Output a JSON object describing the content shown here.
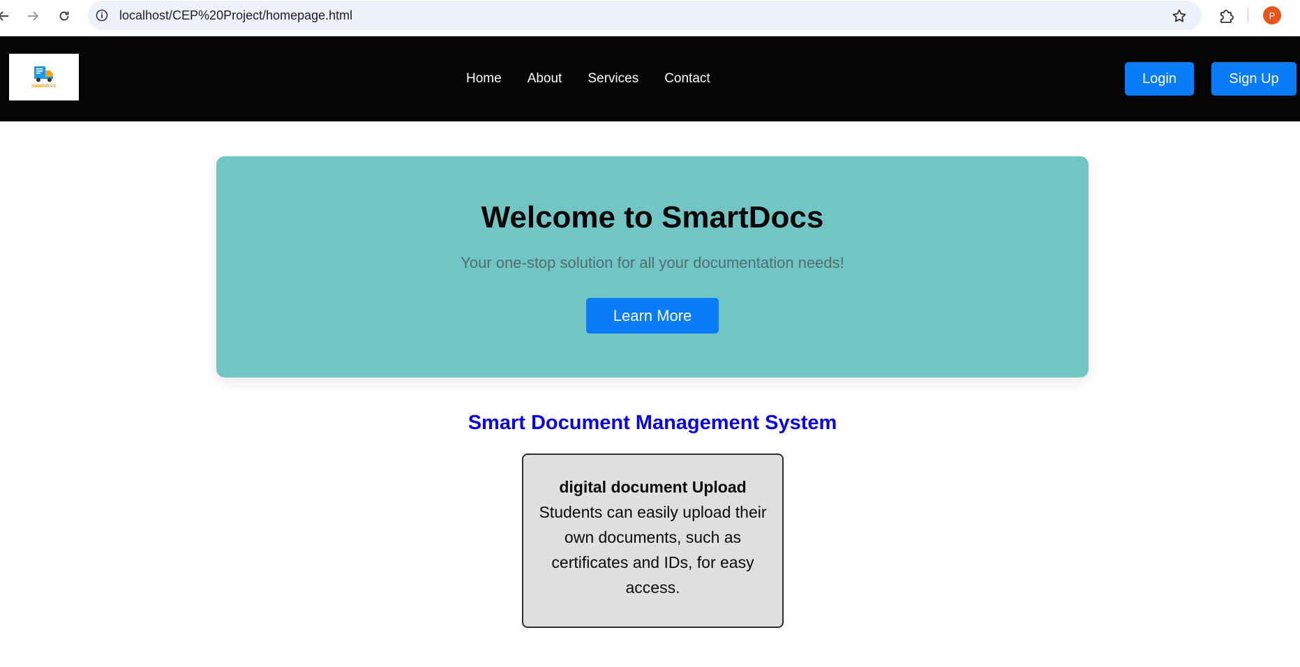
{
  "browser": {
    "url": "localhost/CEP%20Project/homepage.html",
    "profile_initial": "P",
    "icons": [
      "back-icon",
      "forward-icon",
      "reload-icon",
      "site-info-icon",
      "bookmark-star-icon",
      "extensions-icon"
    ]
  },
  "header": {
    "logo_text": "smartdocs",
    "nav": [
      "Home",
      "About",
      "Services",
      "Contact"
    ],
    "login_label": "Login",
    "signup_label": "Sign Up"
  },
  "hero": {
    "title": "Welcome to SmartDocs",
    "subtitle": "Your one-stop solution for all your documentation needs!",
    "cta_label": "Learn More"
  },
  "features": {
    "section_title": "Smart Document Management System",
    "cards": [
      {
        "title": "digital document Upload",
        "description": "Students can easily upload their own documents, such as certificates and IDs, for easy access."
      }
    ]
  },
  "colors": {
    "header_bg": "#050505",
    "accent_blue": "#0a7cf8",
    "hero_bg": "#71c6c5",
    "section_title": "#0a00f0",
    "card_bg": "#dfdfdf"
  }
}
